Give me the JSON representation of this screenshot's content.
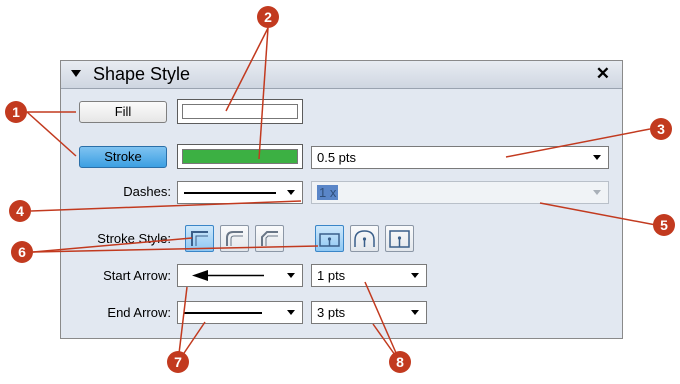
{
  "panel": {
    "title": "Shape Style",
    "close_label": "✕"
  },
  "fill": {
    "button_label": "Fill",
    "color": "#ffffff"
  },
  "stroke": {
    "button_label": "Stroke",
    "color": "#3cb043",
    "width_value": "0.5 pts"
  },
  "dashes": {
    "label": "Dashes:",
    "pattern_value": "1 x"
  },
  "stroke_style": {
    "label": "Stroke Style:",
    "join_icons": [
      "miter-join-icon",
      "round-join-icon",
      "bevel-join-icon"
    ],
    "cap_icons": [
      "butt-cap-icon",
      "round-cap-icon",
      "square-cap-icon"
    ]
  },
  "start_arrow": {
    "label": "Start Arrow:",
    "size_value": "1 pts"
  },
  "end_arrow": {
    "label": "End Arrow:",
    "size_value": "3 pts"
  },
  "callouts": [
    "1",
    "2",
    "3",
    "4",
    "5",
    "6",
    "7",
    "8"
  ],
  "colors": {
    "callout": "#c23a1f",
    "accent": "#3c9fe2"
  }
}
